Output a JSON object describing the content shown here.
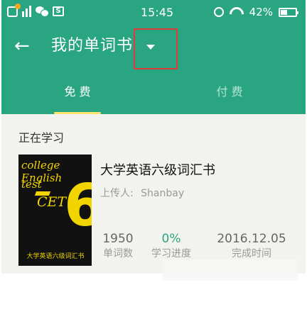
{
  "status_bar": {
    "time": "15:45",
    "battery": "42%",
    "icons": [
      "app-icon",
      "signal-icon",
      "wechat-icon",
      "s-icon",
      "alarm-icon",
      "wifi-icon",
      "battery-icon"
    ]
  },
  "toolbar": {
    "title": "我的单词书",
    "back_icon": "back-arrow-icon",
    "dropdown_icon": "caret-down-icon"
  },
  "tabs": [
    {
      "label": "免 费",
      "active": true
    },
    {
      "label": "付 费",
      "active": false
    }
  ],
  "section": {
    "title": "正在学习"
  },
  "book": {
    "title": "大学英语六级词汇书",
    "uploader_label": "上传人:",
    "uploader": "Shanbay",
    "cover": {
      "line1": "college English",
      "line2": "test",
      "cet": "CET",
      "number": "6",
      "bottom": "大学英语六级词汇书"
    },
    "stats": [
      {
        "value": "1950",
        "label": "单词数"
      },
      {
        "value": "0%",
        "label": "学习进度"
      },
      {
        "value": "2016.12.05",
        "label": "完成时间"
      }
    ]
  },
  "colors": {
    "primary": "#2aa582",
    "indicator": "#ffe26b",
    "highlight_box": "#e03a3a"
  }
}
